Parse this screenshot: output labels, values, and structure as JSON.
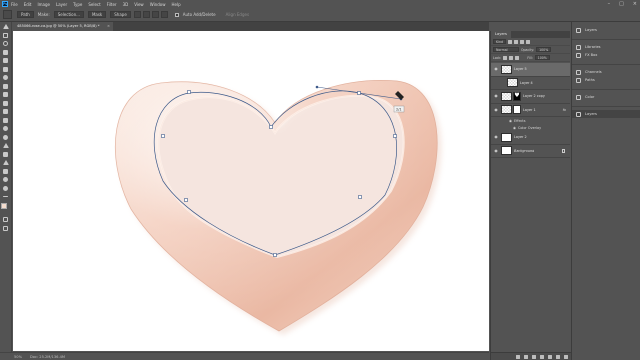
{
  "menubar": {
    "logo": "Ps",
    "items": [
      "File",
      "Edit",
      "Image",
      "Layer",
      "Type",
      "Select",
      "Filter",
      "3D",
      "View",
      "Window",
      "Help"
    ]
  },
  "options": {
    "mode": "Path",
    "make_label": "Make:",
    "selection_button": "Selection...",
    "mask_button": "Mask",
    "shape_button": "Shape",
    "auto_add_delete": "Auto Add/Delete",
    "align_edges": "Align Edges"
  },
  "document": {
    "tab_title": "485066-rose-ca.jpg @ 50% (Layer 5, RGB/8) *",
    "close": "×"
  },
  "status": {
    "zoom": "50%",
    "doc_size": "Doc: 25.2M/136.4M"
  },
  "canvas": {
    "tooltip": "2/1"
  },
  "layers_panel": {
    "tab": "Layers",
    "filter_kind": "Kind",
    "blend_mode": "Normal",
    "opacity_label": "Opacity:",
    "opacity": "100%",
    "lock_label": "Lock:",
    "fill_label": "Fill:",
    "fill": "100%",
    "layers": [
      {
        "name": "Layer 5",
        "thumb": "checker",
        "active": true
      },
      {
        "name": "Layer 4",
        "thumb": "checker",
        "indent": true
      },
      {
        "name": "Layer 2 copy",
        "thumb": "checker",
        "mask": true
      },
      {
        "name": "Layer 1",
        "thumb": "checker",
        "fx": "fx"
      },
      {
        "name": "Layer 2",
        "thumb": "white"
      },
      {
        "name": "Background",
        "thumb": "white",
        "locked": true
      }
    ],
    "effects_label": "Effects",
    "effect_item": "Color Overlay"
  },
  "dock": {
    "group1": [
      "Layers"
    ],
    "group2": [
      "Libraries",
      "FX Box"
    ],
    "group3": [
      "Channels",
      "Paths"
    ],
    "group4": [
      "Color"
    ],
    "group5": [
      "Layers"
    ]
  },
  "colors": {
    "heart_light": "#f8e3d8",
    "heart_mid": "#efc4b0",
    "heart_dark": "#d99f88",
    "path_stroke": "#3d5a8a",
    "foreground": "#f4dccd"
  }
}
